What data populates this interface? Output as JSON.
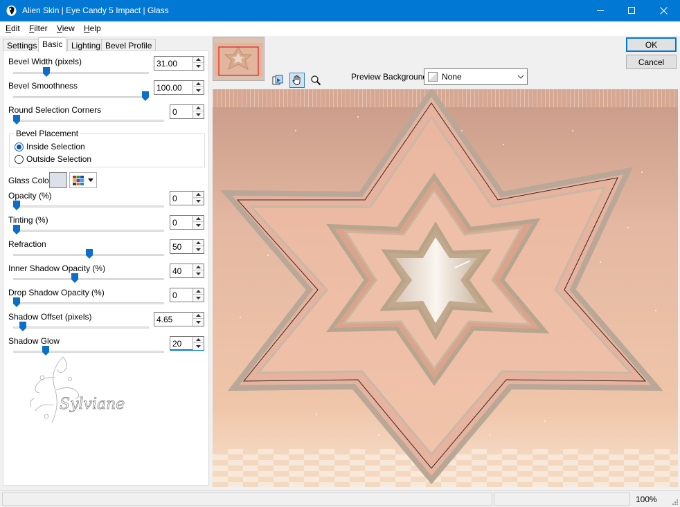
{
  "window": {
    "title": "Alien Skin | Eye Candy 5 Impact | Glass",
    "controls": [
      "minimize",
      "maximize",
      "close"
    ]
  },
  "menu": {
    "items": [
      {
        "label": "Edit",
        "key": "E",
        "rest": "dit"
      },
      {
        "label": "Filter",
        "key": "F",
        "rest": "ilter"
      },
      {
        "label": "View",
        "key": "V",
        "rest": "iew"
      },
      {
        "label": "Help",
        "key": "H",
        "rest": "elp"
      }
    ]
  },
  "tabs": [
    "Settings",
    "Basic",
    "Lighting",
    "Bevel Profile"
  ],
  "active_tab": "Basic",
  "controls": {
    "bevel_width": {
      "label": "Bevel Width (pixels)",
      "value": "31.00",
      "level": 0.24
    },
    "bevel_smoothness": {
      "label": "Bevel Smoothness",
      "value": "100.00",
      "level": 1.0
    },
    "round_corners": {
      "label": "Round Selection Corners",
      "value": "0",
      "level": 0.0
    },
    "bevel_placement": {
      "title": "Bevel Placement",
      "options": [
        "Inside Selection",
        "Outside Selection"
      ],
      "selected": "Inside Selection"
    },
    "glass_color": {
      "label": "Glass Color",
      "color": "#dbe0ea"
    },
    "opacity": {
      "label": "Opacity (%)",
      "value": "0",
      "level": 0.0
    },
    "tinting": {
      "label": "Tinting (%)",
      "value": "0",
      "level": 0.0
    },
    "refraction": {
      "label": "Refraction",
      "value": "50",
      "level": 0.5
    },
    "inner_shadow_opacity": {
      "label": "Inner Shadow Opacity (%)",
      "value": "40",
      "level": 0.4
    },
    "drop_shadow_opacity": {
      "label": "Drop Shadow Opacity (%)",
      "value": "0",
      "level": 0.0
    },
    "shadow_offset": {
      "label": "Shadow Offset (pixels)",
      "value": "4.65",
      "level": 0.05
    },
    "shadow_glow": {
      "label": "Shadow Glow",
      "value": "20",
      "level": 0.2
    }
  },
  "watermark": {
    "text": "Sylviane"
  },
  "preview": {
    "background_label": "Preview Background:",
    "background_value": "None",
    "tools": [
      "preview-compare-icon",
      "hand-icon",
      "zoom-icon"
    ]
  },
  "buttons": {
    "ok": "OK",
    "cancel": "Cancel"
  },
  "status": {
    "zoom": "100%"
  },
  "colors": {
    "titlebar": "#0078d4",
    "accent": "#0078d4",
    "slider_thumb": "#0b6fc9",
    "preview_peach": "#e8b8a0"
  }
}
